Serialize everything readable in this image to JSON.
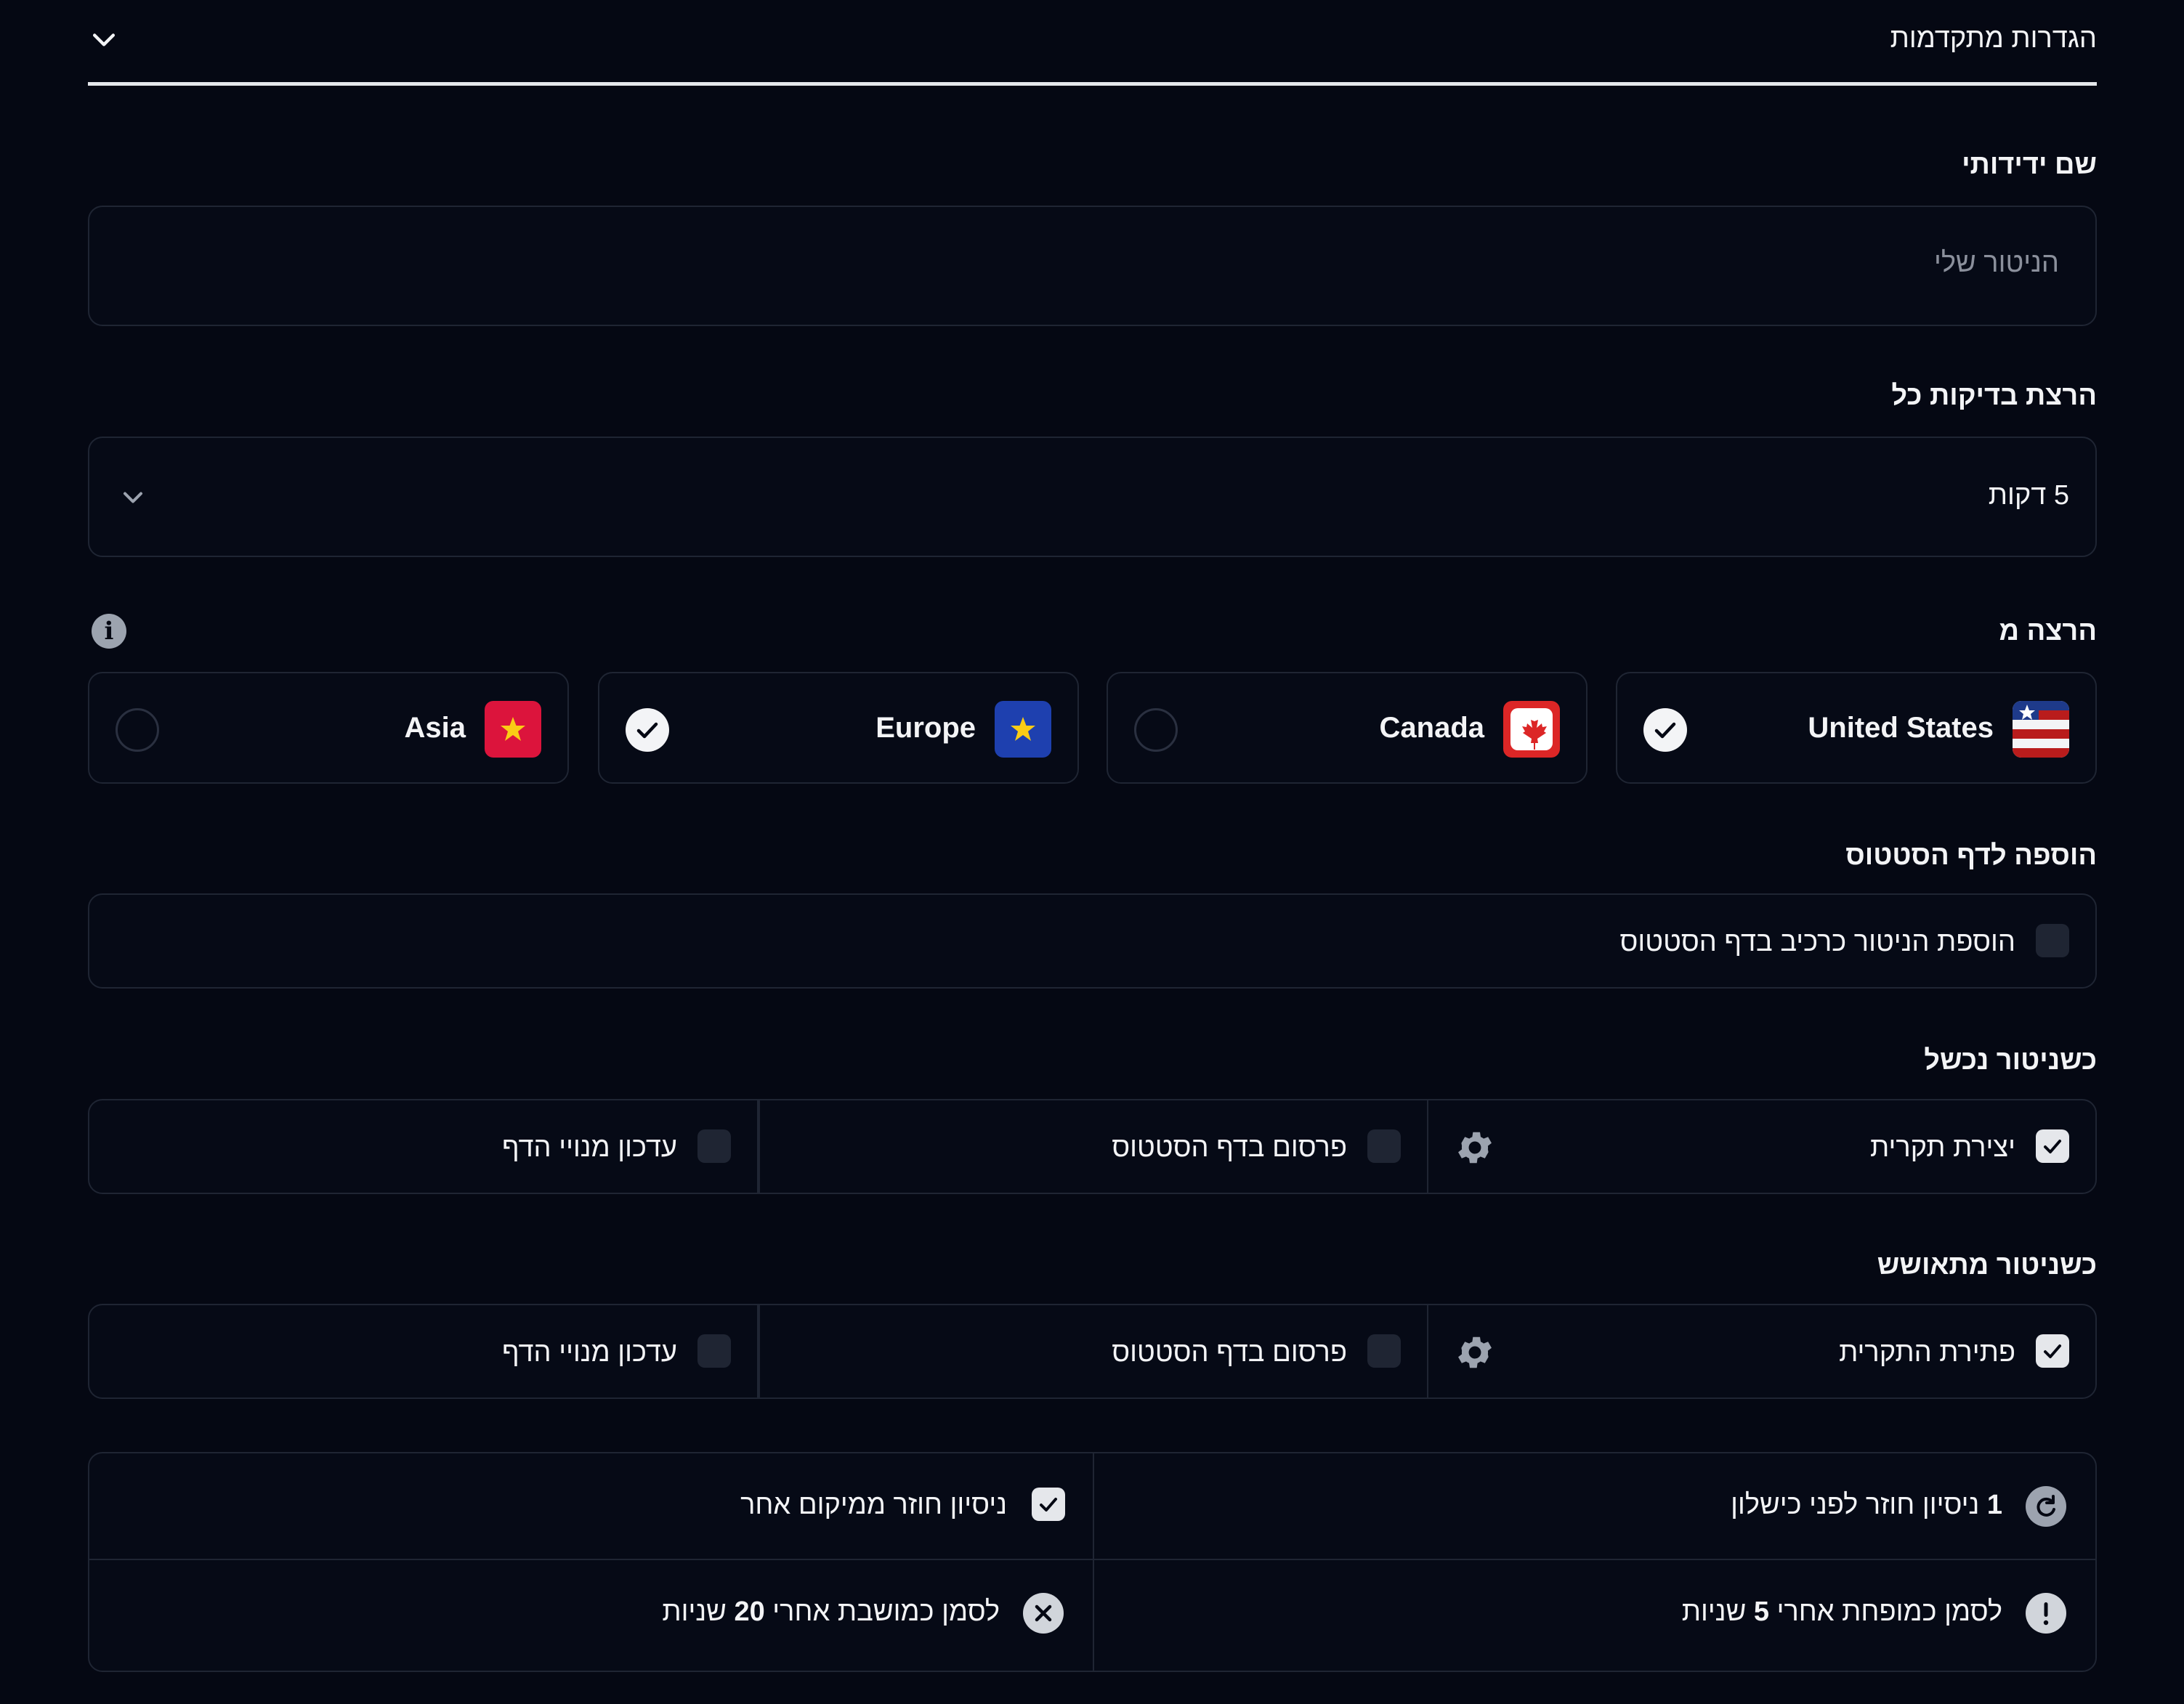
{
  "advanced": {
    "title": "הגדרות מתקדמות"
  },
  "friendly_name": {
    "label": "שם ידידותי",
    "placeholder": "הניטור שלי"
  },
  "interval": {
    "label": "הרצת בדיקות כל",
    "value": "5 דקות"
  },
  "run_from": {
    "label": "הרצה מ",
    "locations": [
      {
        "name": "United States",
        "flag": "us-flag-icon",
        "selected": true
      },
      {
        "name": "Canada",
        "flag": "canada-flag-icon",
        "selected": false
      },
      {
        "name": "Europe",
        "flag": "eu-flag-icon",
        "selected": true
      },
      {
        "name": "Asia",
        "flag": "asia-flag-icon",
        "selected": false
      }
    ]
  },
  "status_page": {
    "label": "הוספה לדף הסטטוס",
    "option": "הוספת הניטור כרכיב בדף הסטטוס",
    "checked": false
  },
  "on_failure": {
    "label": "כשניטור נכשל",
    "create_incident": "יצירת תקרית",
    "publish": "פרסום בדף הסטטוס",
    "notify": "עדכון מנויי הדף"
  },
  "on_recovery": {
    "label": "כשניטור מתאושש",
    "resolve_incident": "פתירת התקרית",
    "publish": "פרסום בדף הסטטוס",
    "notify": "עדכון מנויי הדף"
  },
  "retries": {
    "count": "1",
    "count_text": "ניסיון חוזר לפני כישלון",
    "other_location": "ניסיון חוזר ממיקום אחר",
    "degraded_prefix": "לסמן כמופחת אחרי",
    "degraded_value": "5",
    "degraded_suffix": "שניות",
    "failed_prefix": "לסמן כמושבת אחרי",
    "failed_value": "20",
    "failed_suffix": "שניות"
  },
  "colors": {
    "background": "#050813",
    "border": "#1f2533",
    "text": "#f3f4f6",
    "muted": "#8b909c"
  }
}
